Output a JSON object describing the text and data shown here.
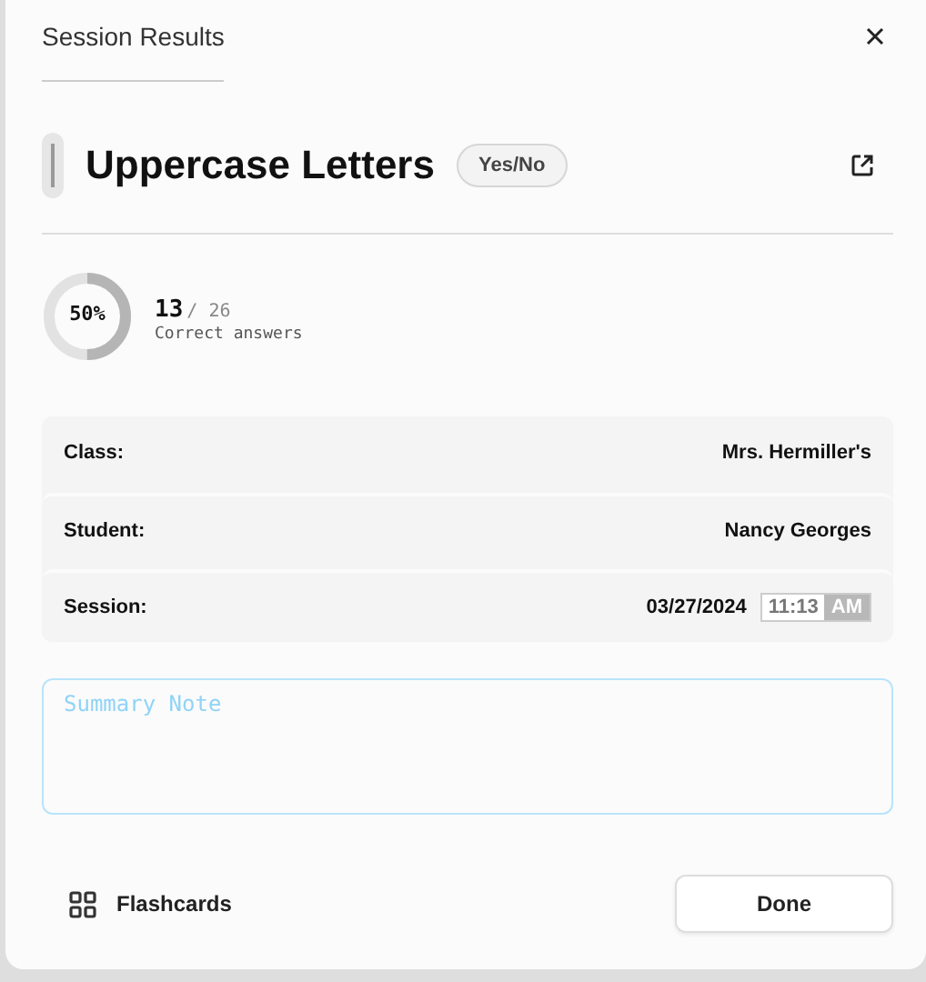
{
  "dialog": {
    "title": "Session Results"
  },
  "deck": {
    "title": "Uppercase Letters",
    "tag": "Yes/No"
  },
  "score": {
    "percent": "50%",
    "level": 0.5,
    "correct": "13",
    "total": "/ 26",
    "caption": "Correct answers"
  },
  "details": [
    {
      "label": "Class:",
      "value": "Mrs. Hermiller's"
    },
    {
      "label": "Student:",
      "value": "Nancy Georges"
    },
    {
      "label": "Session:",
      "value": "03/27/2024",
      "time": "11:13",
      "meridiem": "AM"
    }
  ],
  "note": {
    "placeholder": "Summary Note"
  },
  "footer": {
    "link": "Flashcards",
    "button": "Done"
  }
}
